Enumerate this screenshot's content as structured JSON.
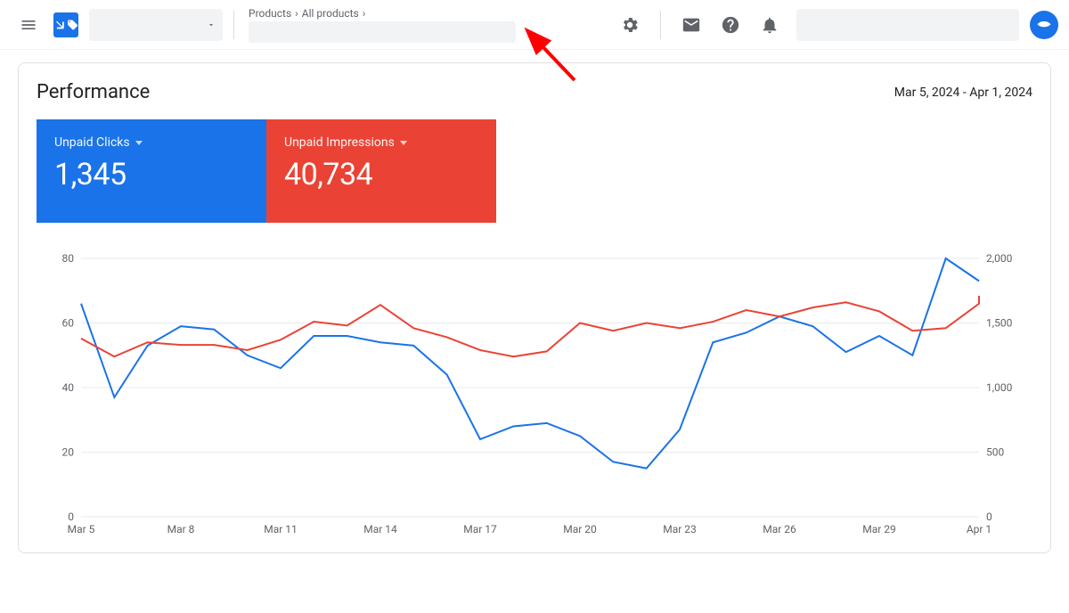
{
  "header": {
    "breadcrumb": [
      "Products",
      "All products"
    ]
  },
  "card": {
    "title": "Performance",
    "date_range": "Mar 5, 2024 - Apr 1, 2024"
  },
  "metrics": [
    {
      "label": "Unpaid Clicks",
      "value": "1,345",
      "color": "blue"
    },
    {
      "label": "Unpaid Impressions",
      "value": "40,734",
      "color": "red"
    }
  ],
  "chart_data": {
    "type": "line",
    "title": "",
    "xlabel": "",
    "x_categories": [
      "Mar 5",
      "Mar 6",
      "Mar 7",
      "Mar 8",
      "Mar 9",
      "Mar 10",
      "Mar 11",
      "Mar 12",
      "Mar 13",
      "Mar 14",
      "Mar 15",
      "Mar 16",
      "Mar 17",
      "Mar 18",
      "Mar 19",
      "Mar 20",
      "Mar 21",
      "Mar 22",
      "Mar 23",
      "Mar 24",
      "Mar 25",
      "Mar 26",
      "Mar 27",
      "Mar 28",
      "Mar 29",
      "Mar 30",
      "Mar 31",
      "Apr 1"
    ],
    "x_tick_labels": [
      "Mar 5",
      "Mar 8",
      "Mar 11",
      "Mar 14",
      "Mar 17",
      "Mar 20",
      "Mar 23",
      "Mar 26",
      "Mar 29",
      "Apr 1"
    ],
    "series": [
      {
        "name": "Unpaid Clicks",
        "axis": "left",
        "color": "#1a73e8",
        "values": [
          66,
          37,
          53,
          59,
          58,
          50,
          46,
          56,
          56,
          54,
          53,
          44,
          24,
          28,
          29,
          25,
          17,
          15,
          27,
          54,
          57,
          62,
          59,
          51,
          56,
          50,
          80,
          73
        ]
      },
      {
        "name": "Unpaid Impressions",
        "axis": "right",
        "color": "#ea4335",
        "values": [
          1380,
          1240,
          1350,
          1330,
          1330,
          1290,
          1370,
          1510,
          1480,
          1640,
          1460,
          1390,
          1290,
          1240,
          1280,
          1500,
          1440,
          1500,
          1460,
          1510,
          1600,
          1550,
          1620,
          1660,
          1590,
          1440,
          1460,
          1650,
          1700,
          1710
        ]
      }
    ],
    "left_axis": {
      "label": "",
      "ylim": [
        0,
        80
      ],
      "ticks": [
        0,
        20,
        40,
        60,
        80
      ]
    },
    "right_axis": {
      "label": "",
      "ylim": [
        0,
        2000
      ],
      "ticks": [
        0,
        500,
        1000,
        1500,
        2000
      ]
    },
    "grid": true,
    "legend_position": "cards-above"
  }
}
